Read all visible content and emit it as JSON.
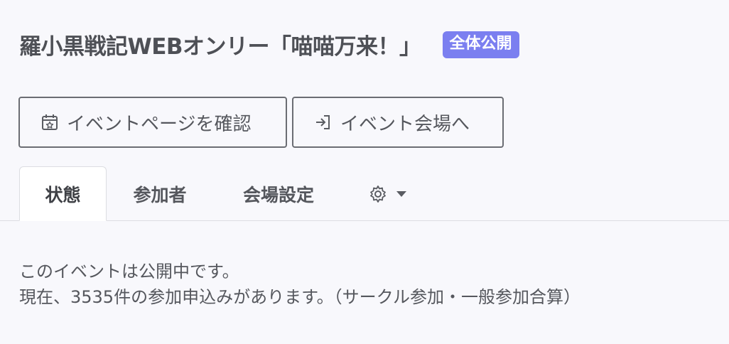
{
  "header": {
    "title": "羅小黒戦記WEBオンリー「喵喵万来！」",
    "badge": "全体公開"
  },
  "buttons": {
    "event_page": {
      "label": "イベントページを確認",
      "icon": "calendar-star-icon"
    },
    "enter_venue": {
      "label": "イベント会場へ",
      "icon": "sign-in-icon"
    }
  },
  "tabs": {
    "status": "状態",
    "participants": "参加者",
    "venue_settings": "会場設定",
    "settings_icon": "gear-icon"
  },
  "status": {
    "line1": "このイベントは公開中です。",
    "line2": "現在、3535件の参加申込みがあります。（サークル参加・一般参加合算）"
  },
  "colors": {
    "badge": "#7b7ff0",
    "background": "#f8f8fc",
    "text": "#4e5056"
  }
}
